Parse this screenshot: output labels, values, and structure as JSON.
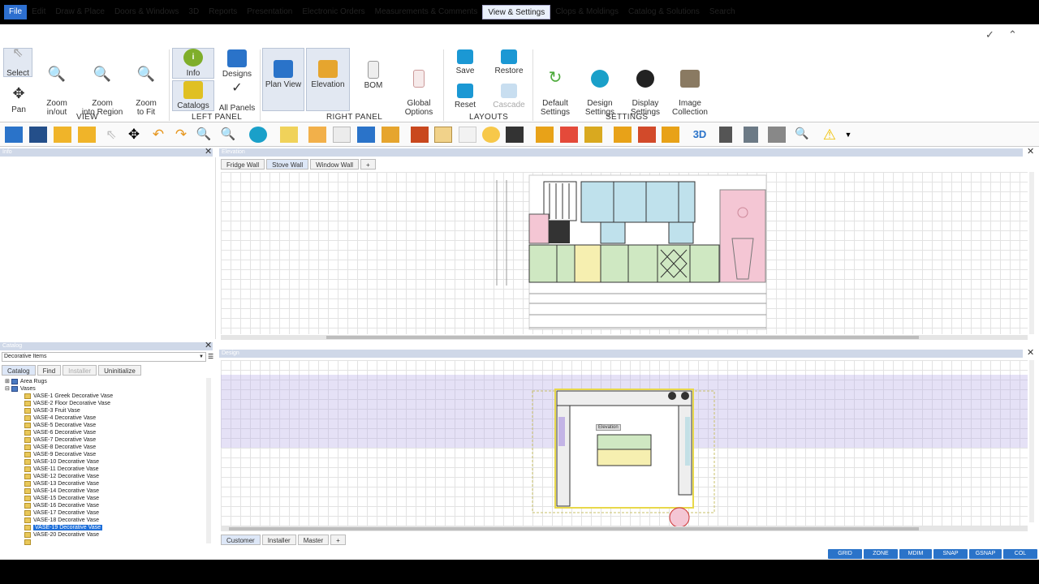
{
  "menu": {
    "items": [
      "File",
      "Edit",
      "Draw & Place",
      "Doors & Windows",
      "3D",
      "Reports",
      "Presentation",
      "Electronic Orders",
      "Measurements & Comments",
      "View & Settings",
      "Clops & Moldings",
      "Catalog & Solutions",
      "Search"
    ]
  },
  "window": {
    "check_icon": "checkmark-icon",
    "collapse_icon": "caret-up-icon"
  },
  "ribbon": {
    "view": {
      "select": "Select",
      "pan": "Pan",
      "zoom_inout": "Zoom\nin/out",
      "zoom_region": "Zoom\ninto Region",
      "zoom_fit": "Zoom\nto Fit",
      "label": "VIEW"
    },
    "left_panel": {
      "info": "Info",
      "designs": "Designs",
      "catalogs": "Catalogs",
      "all_panels": "All Panels",
      "label": "LEFT PANEL"
    },
    "right_panel": {
      "plan_view": "Plan View",
      "elevation": "Elevation",
      "bom": "BOM",
      "global_options": "Global\nOptions",
      "label": "RIGHT PANEL"
    },
    "layouts": {
      "save": "Save",
      "restore": "Restore",
      "reset": "Reset",
      "cascade": "Cascade",
      "label": "LAYOUTS"
    },
    "settings": {
      "default": "Default\nSettings",
      "design": "Design\nSettings",
      "display": "Display\nSettings",
      "image": "Image\nCollection",
      "label": "SETTINGS"
    }
  },
  "toolbar": {
    "three_d": "3D"
  },
  "info_panel": {
    "title": "Info"
  },
  "elevation_panel": {
    "title": "Elevation",
    "tabs": [
      "Fridge Wall",
      "Stove Wall",
      "Window Wall",
      "+"
    ]
  },
  "design_panel": {
    "title": "Design",
    "tabs": [
      "Customer",
      "Installer",
      "Master",
      "+"
    ],
    "label_in_plan": "Elevation"
  },
  "catalog_panel": {
    "title": "Catalog",
    "dropdown": "Decorative Items",
    "tabs": [
      "Catalog",
      "Find",
      "Installer",
      "Uninitialize"
    ],
    "tree": [
      "Area Rugs",
      "Vases",
      "VASE-1 Greek Decorative Vase",
      "VASE-2 Floor Decorative Vase",
      "VASE-3 Fruit Vase",
      "VASE-4 Decorative Vase",
      "VASE-5 Decorative Vase",
      "VASE-6 Decorative Vase",
      "VASE-7 Decorative Vase",
      "VASE-8 Decorative Vase",
      "VASE-9 Decorative Vase",
      "VASE-10 Decorative Vase",
      "VASE-11 Decorative Vase",
      "VASE-12 Decorative Vase",
      "VASE-13 Decorative Vase",
      "VASE-14 Decorative Vase",
      "VASE-15 Decorative Vase",
      "VASE-16 Decorative Vase",
      "VASE-17 Decorative Vase",
      "VASE-18 Decorative Vase",
      "VASE-19 Decorative Vase",
      "VASE-20 Decorative Vase"
    ],
    "selected": "VASE-18 Decorative Vase"
  },
  "statusbar": [
    "GRID",
    "ZONE",
    "MDIM",
    "SNAP",
    "GSNAP",
    "COL"
  ],
  "colors": {
    "accent": "#2a73c9",
    "file_menu": "#2d6fcf",
    "cabinet_green": "#cfe8c2",
    "cabinet_blue": "#bfe1ec",
    "cabinet_pink": "#f4c6d4",
    "plan_band": "#c9c3ec"
  }
}
